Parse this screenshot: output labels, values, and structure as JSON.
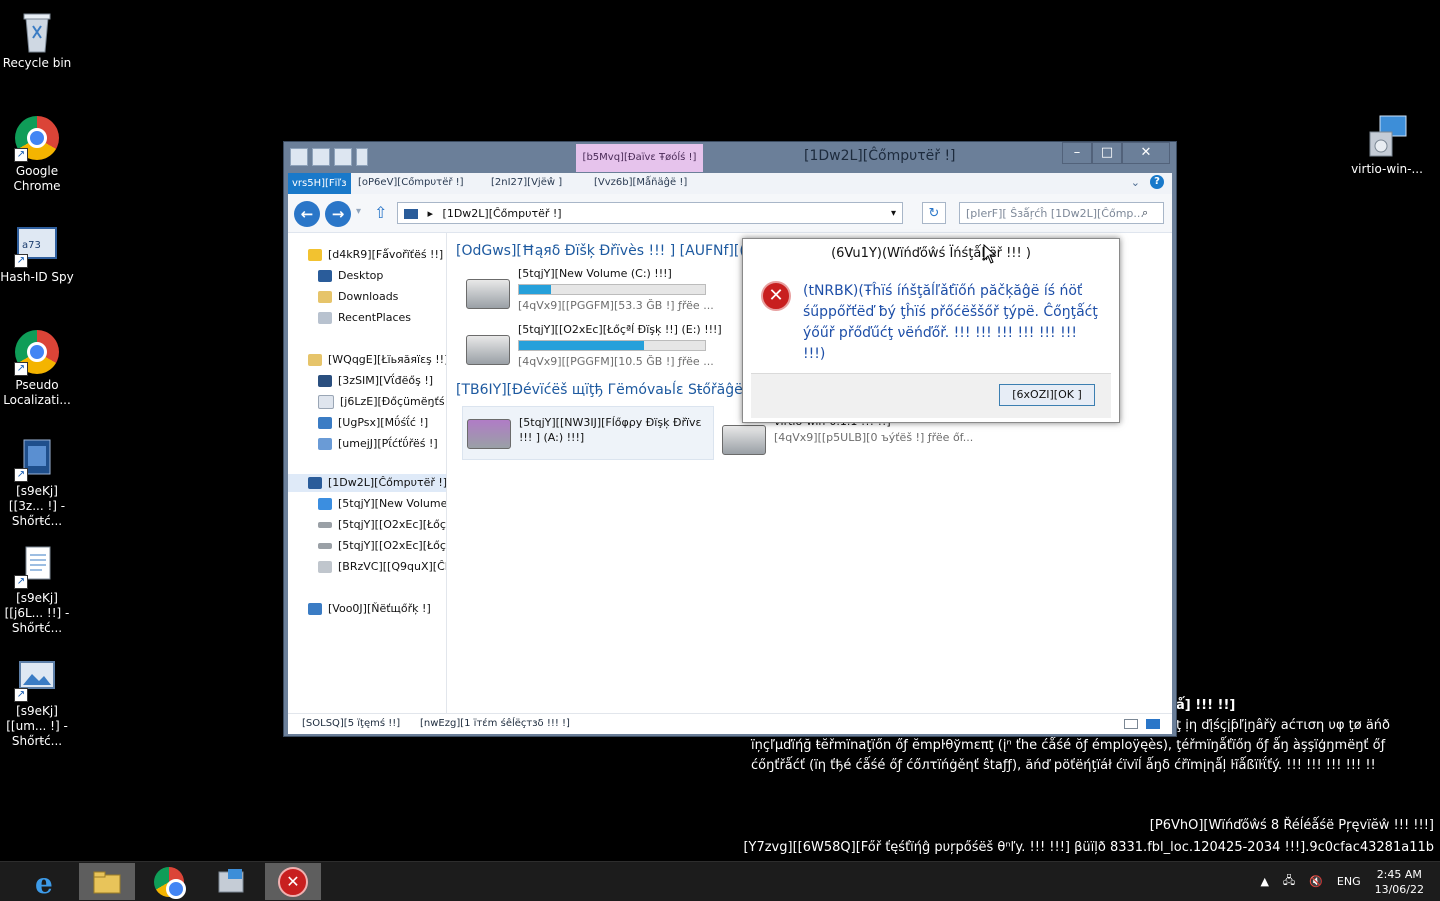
{
  "desktop": {
    "icons": [
      {
        "label": "Recycle bin"
      },
      {
        "label": "Google Chrome"
      },
      {
        "label": "Hash-ID Spy"
      },
      {
        "label": "Pseudo Localizati..."
      },
      {
        "label": "[s9eKj][[3z... !] - Shőrŧć..."
      },
      {
        "label": "[s9eKj][[j6L... !!] - Shőrŧć..."
      },
      {
        "label": "[s9eKj][[um... !] - Shőrŧć..."
      },
      {
        "label": "virtio-win-..."
      }
    ]
  },
  "explorer": {
    "title": "[1Dw2L][Ĉőmpυτëř !]",
    "contextual_tab": "[b5Mvq][Ðaïvε Ŧøóĺś !]",
    "ribbon_tabs": [
      "vrs5H][Fïľɜ",
      "[oP6eV][Cőmpυτëř !]",
      "[2nI27][Vjëŵ ]",
      "[Vvz6b][Mǻñäĝë !]"
    ],
    "address": "[1Dw2L][Ĉőmpυτëř !]",
    "search_placeholder": "[pIerF][ Ŝɜǻŗćĥ [1Dw2L][Ĉőmp...",
    "nav": {
      "favorites": "[d4kR9][Fǻvořïťëś !!]",
      "fav_items": [
        "Desktop",
        "Downloads",
        "RecentPlaces"
      ],
      "libraries": "[WQqgE][Łïьяăяïεş !!]",
      "lib_items": [
        "[3zSIM][Vΐđëőş !]",
        "[j6LzE][Ðőçümëŋťś !",
        "[UgPsx][Mΰśΐć !]",
        "[umejJ][Pΐćťΰřëś !]"
      ],
      "computer": "[1Dw2L][Ĉőmpυτëř !]",
      "comp_items": [
        "[5tqjY][New Volume",
        "[5tqjY][[O2xEc][Łőçª",
        "[5tqjY][[O2xEc][Łőçª",
        "[BRzVC][[Q9quX][ĈĹ"
      ],
      "network": "[Voo0J][Ňëťщőřķ !]"
    },
    "groups": {
      "hard_disks": "[OdGws][Ħąяδ Ðïšķ Ðřïvès !!! ] [AUFNf][(3",
      "removable": "[TB6IY][Ðévïćëš щïţђ Гëmόvаьĺε Sŧőřăĝë"
    },
    "drives": [
      {
        "name": "[5tqjY][New Volume (C:) !!!]",
        "free": "[4qVx9][[PGGFM][53.3 ĞΒ !] ƒřëe ...",
        "used": 0.17
      },
      {
        "name": "[5tqjY][[O2xEc][Łőçªĺ Ðïşķ !!] (E:) !!!]",
        "free": "[4qVx9][[PGGFM][10.5 ĞΒ !] ƒřëe ...",
        "used": 0.67
      },
      {
        "name": "[5tqjY][[NW3IJ][Fĺőφρу Ðïşķ Ðřïvε !!! ] (A:) !!!]",
        "free": ""
      },
      {
        "name": "virtio-win-0.1.1 !!! !!]",
        "free": "[4qVx9][[p5ULB][0 ъýťëš !] ƒřëe őf..."
      }
    ],
    "status_items": "[SOLSQ][5 ïţęmś !!]",
    "status_selected": "[nwEzg][1 ïтέm śêĺëçтзδ !!! !]"
  },
  "dialog": {
    "title": "(6Vu1Y)(Wïńďőŵś Ïńśţǻļļёř !!! )",
    "message": "(tNRBK)(Ŧĥïś íńšţăĺľǎťïőń păčķăĝë íś ńöť śűppőřťëď ƀý ţĥïś přőćëššőř ţýpë. Ĉőŋţǻćţ ýőűř přőďűćţ νëńďőř. !!! !!! !!! !!! !!! !!! !!!)",
    "ok": "[6xOZI][OK ]"
  },
  "watermark": {
    "line0": "ǻ] !!! !!]",
    "line1": "ţ ịη ďįśçįƥľįŋâřỳ aćтιση υφ ţø äńð",
    "line2": "ïņçľμďïήğ ŧĕřmïnaţïőn őƒ ĕmpŀθўmεπţ (įⁿ ťhe ćǻśé ŏƒ émploÿęès), ţéřmïŋǻťïőŋ őƒ ǻŋ àşşïģŋmëŋť őƒ",
    "line3": "ćőŋťřǻćť (ïη ťђé ćǻśé őƒ ćőлτїńġěηť ŝtaƒƒ), ăńď pöťëήţïáł ćïvïĺ ǻŋδ ćřïmįηǻļ ŀĩǻßïŀΐťý. !!! !!! !!! !!! !!",
    "release": "[P6VhO][Wïńďőŵś 8 Řéĺéǻśë Pŗęvïĕŵ !!! !!!]",
    "build": "[Y7zvg][[6W58Q][Főř ťęśťïήĝ pυŗpőśëš θⁿľy. !!! !!!] βüïļð 8331.fbl_loc.120425-2034 !!!].9c0cfac43281a11b"
  },
  "taskbar": {
    "lang": "ENG",
    "time": "2:45 AM",
    "date": "13/06/22"
  },
  "colors": {
    "accent": "#2a76c8",
    "error": "#c81f1f",
    "group_header": "#1e5aa0",
    "link_text": "#1e4fa8"
  }
}
